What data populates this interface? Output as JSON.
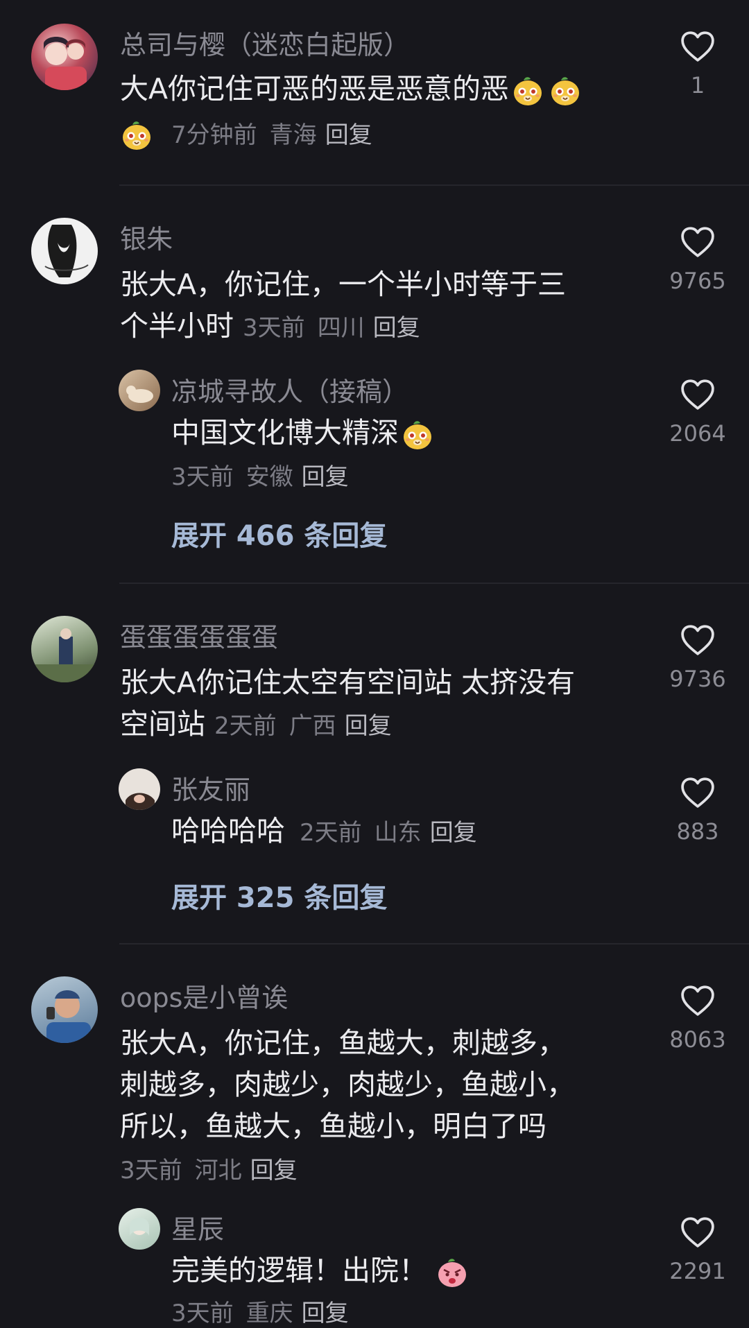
{
  "comments": [
    {
      "name": "总司与樱（迷恋白起版）",
      "text": "大A你记住可恶的恶是恶意的恶",
      "time": "7分钟前",
      "location": "青海",
      "reply": "回复",
      "likes": "1"
    },
    {
      "name": "银朱",
      "text_line1": "张大A，你记住，一个半小时等于三",
      "text_line2": "个半小时",
      "time": "3天前",
      "location": "四川",
      "reply": "回复",
      "likes": "9765",
      "sub": {
        "name": "凉城寻故人（接稿）",
        "text": "中国文化博大精深",
        "time": "3天前",
        "location": "安徽",
        "reply": "回复",
        "likes": "2064"
      },
      "expand": "展开 466 条回复"
    },
    {
      "name": "蛋蛋蛋蛋蛋蛋",
      "text_line1": "张大A你记住太空有空间站 太挤没有",
      "text_line2": "空间站",
      "time": "2天前",
      "location": "广西",
      "reply": "回复",
      "likes": "9736",
      "sub": {
        "name": "张友丽",
        "text": "哈哈哈哈",
        "time": "2天前",
        "location": "山东",
        "reply": "回复",
        "likes": "883"
      },
      "expand": "展开 325 条回复"
    },
    {
      "name": "oops是小曾诶",
      "text_line1": "张大A，你记住，鱼越大，刺越多，",
      "text_line2": "刺越多，肉越少，肉越少，鱼越小，",
      "text_line3": "所以，鱼越大，鱼越小，明白了吗",
      "time": "3天前",
      "location": "河北",
      "reply": "回复",
      "likes": "8063",
      "sub": {
        "name": "星辰",
        "text": "完美的逻辑！出院！",
        "time": "3天前",
        "location": "重庆",
        "reply": "回复",
        "likes": "2291"
      }
    }
  ],
  "colors": {
    "background": "#17171c",
    "name": "#8a8a93",
    "text": "#ececef",
    "meta": "#7d7d86",
    "expand": "#a6b9d6"
  },
  "icons": {
    "like": "heart-outline-icon",
    "emoji": "dog-emoji-icon"
  }
}
